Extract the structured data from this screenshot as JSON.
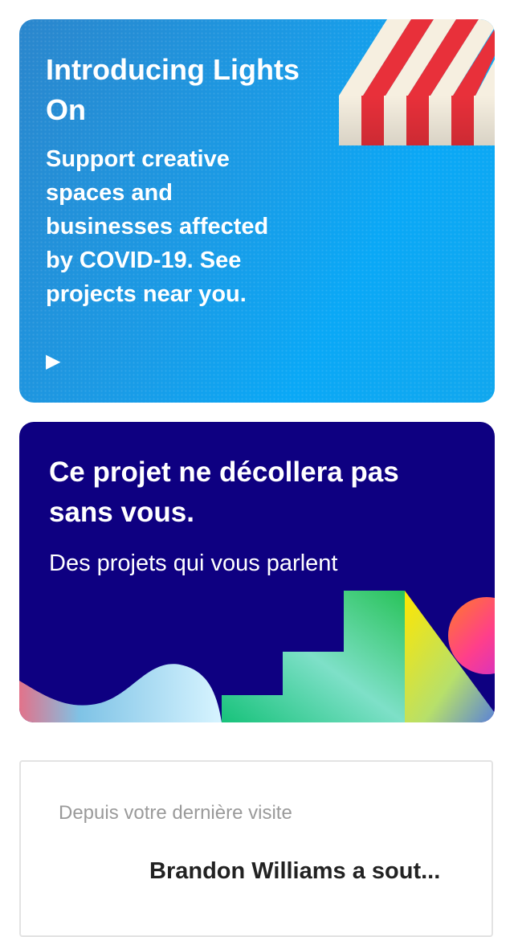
{
  "lights_card": {
    "title": "Introducing Lights On",
    "body": "Support creative spaces and businesses affected by COVID-19. See projects near you.",
    "play_icon": "play-icon",
    "colors": {
      "background": "#1a9be6",
      "awning_red": "#e8303a",
      "awning_cream": "#f6efe0"
    }
  },
  "promo_card": {
    "headline": "Ce projet ne décollera pas sans vous.",
    "subtitle": "Des projets qui vous parlent",
    "colors": {
      "background": "#0e0081"
    }
  },
  "activity_card": {
    "section_label": "Depuis votre dernière visite",
    "item_text": "Brandon Williams a sout..."
  }
}
